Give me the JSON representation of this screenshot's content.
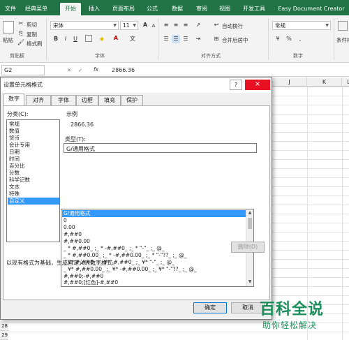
{
  "ribbon": {
    "tabs": [
      "文件",
      "经典菜单",
      "开始",
      "插入",
      "页面布局",
      "公式",
      "数据",
      "审阅",
      "视图",
      "开发工具",
      "Easy Document Creator"
    ],
    "active_tab": "开始",
    "clipboard": {
      "paste": "粘贴",
      "cut": "剪切",
      "copy": "复制",
      "format_painter": "格式刷",
      "label": "剪贴板"
    },
    "font": {
      "name": "宋体",
      "size": "11",
      "label": "字体",
      "bold": "B",
      "italic": "I",
      "underline": "U",
      "grow": "A",
      "shrink": "A",
      "wen": "文"
    },
    "alignment": {
      "wrap": "自动换行",
      "merge": "合并后居中",
      "label": "对齐方式"
    },
    "number": {
      "format": "常规",
      "label": "数字"
    },
    "styles": {
      "conditional": "条件格"
    }
  },
  "formula_bar": {
    "cell": "G2",
    "value": "2866.36",
    "fx": "fx"
  },
  "sheet": {
    "columns": [
      "J",
      "K",
      "L"
    ],
    "rows": [
      "28",
      "29"
    ]
  },
  "dialog": {
    "title": "设置单元格格式",
    "help_button": "?",
    "close_button": "×",
    "tabs": [
      "数字",
      "对齐",
      "字体",
      "边框",
      "填充",
      "保护"
    ],
    "active_tab": "数字",
    "category_label": "分类(C):",
    "categories": [
      "常规",
      "数值",
      "货币",
      "会计专用",
      "日期",
      "时间",
      "百分比",
      "分数",
      "科学记数",
      "文本",
      "特殊",
      "自定义"
    ],
    "selected_category": "自定义",
    "sample_label": "示例",
    "sample_value": "2866.36",
    "type_label": "类型(T):",
    "type_value": "G/通用格式",
    "formats": [
      "G/通用格式",
      "0",
      "0.00",
      "#,##0",
      "#,##0.00",
      "_ * #,##0_ ;_ * -#,##0_ ;_ * \"-\"_ ;_ @_",
      "_ * #,##0.00_ ;_ * -#,##0.00_ ;_ * \"-\"??_ ;_ @_",
      "_ ¥* #,##0_ ;_ ¥* -#,##0_ ;_ ¥* \"-\"_ ;_ @_",
      "_ ¥* #,##0.00_ ;_ ¥* -#,##0.00_ ;_ ¥* \"-\"??_ ;_ @_",
      "#,##0;-#,##0",
      "#,##0;[红色]-#,##0"
    ],
    "delete_button": "删除(D)",
    "description": "以现有格式为基础，生成自定义的数字格式。",
    "ok_button": "确定",
    "cancel_button": "取消"
  },
  "watermark": {
    "title": "百科全说",
    "subtitle": "助你轻松解决"
  },
  "colors": {
    "excel_green": "#217346",
    "selection": "#3399ff",
    "watermark": "#1a8f5a"
  }
}
